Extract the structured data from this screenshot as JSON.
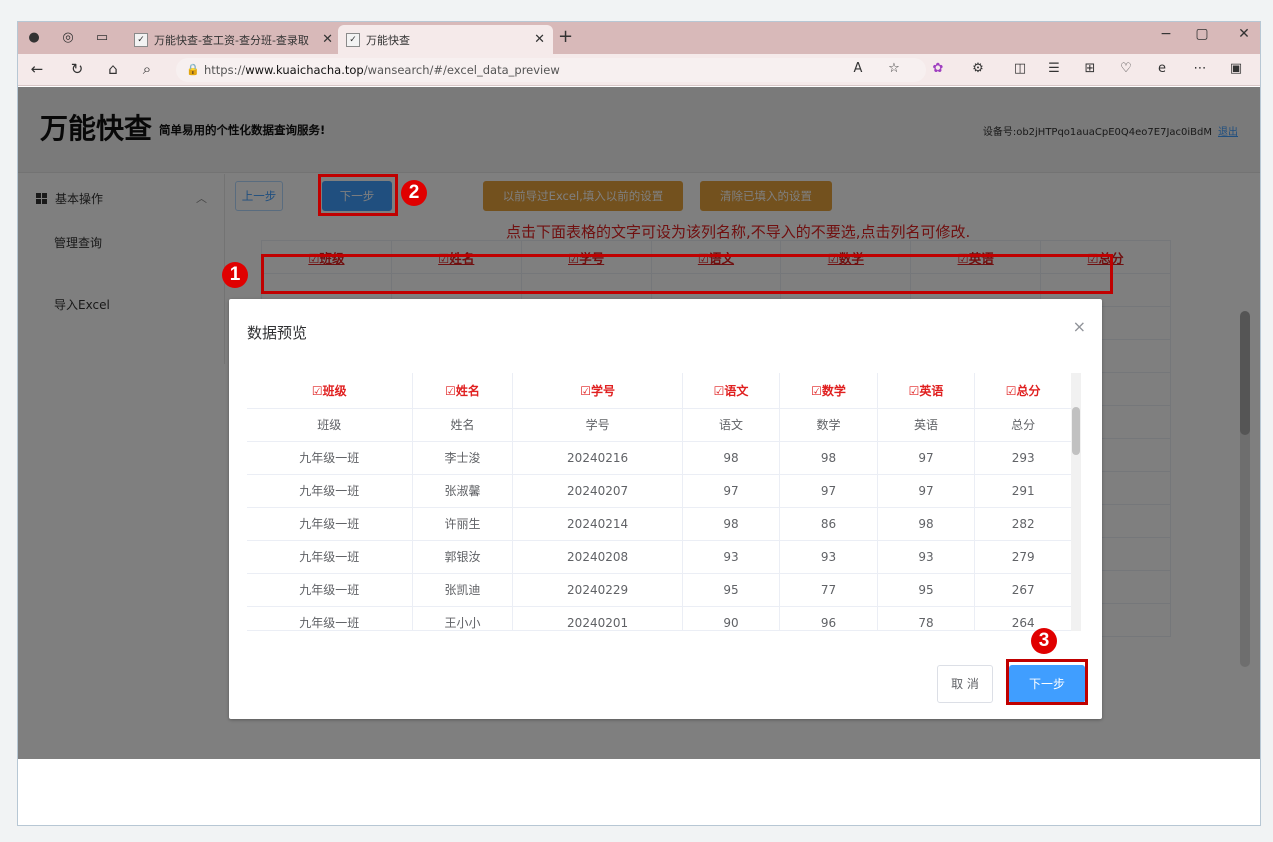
{
  "browser": {
    "tabs": [
      {
        "title": "万能快查-查工资-查分班-查录取",
        "active": false
      },
      {
        "title": "万能快查",
        "active": true
      }
    ],
    "new_tab": "+",
    "url_prefix": "https://",
    "url_domain": "www.kuaichacha.top",
    "url_path": "/wansearch/#/excel_data_preview",
    "window_controls": [
      "−",
      "▢",
      "✕"
    ]
  },
  "header": {
    "logo": "万能快查",
    "slogan": "简单易用的个性化数据查询服务!",
    "device_label": "设备号:ob2jHTPqo1auaCpE0Q4eo7E7Jac0iBdM",
    "logout": "退出"
  },
  "sidebar": {
    "group": "基本操作",
    "items": [
      "管理查询",
      "导入Excel"
    ]
  },
  "toolbar": {
    "prev": "上一步",
    "next": "下一步",
    "load_previous": "以前导过Excel,填入以前的设置",
    "clear": "清除已填入的设置"
  },
  "hint": "点击下面表格的文字可设为该列名称,不导入的不要选,点击列名可修改.",
  "columns": [
    "☑班级",
    "☑姓名",
    "☑学号",
    "☑语文",
    "☑数学",
    "☑英语",
    "☑总分"
  ],
  "dialog": {
    "title": "数据预览",
    "close": "×",
    "columns": [
      "☑班级",
      "☑姓名",
      "☑学号",
      "☑语文",
      "☑数学",
      "☑英语",
      "☑总分"
    ],
    "rows": [
      [
        "班级",
        "姓名",
        "学号",
        "语文",
        "数学",
        "英语",
        "总分"
      ],
      [
        "九年级一班",
        "李士浚",
        "20240216",
        "98",
        "98",
        "97",
        "293"
      ],
      [
        "九年级一班",
        "张淑馨",
        "20240207",
        "97",
        "97",
        "97",
        "291"
      ],
      [
        "九年级一班",
        "许丽生",
        "20240214",
        "98",
        "86",
        "98",
        "282"
      ],
      [
        "九年级一班",
        "郭银汝",
        "20240208",
        "93",
        "93",
        "93",
        "279"
      ],
      [
        "九年级一班",
        "张凯迪",
        "20240229",
        "95",
        "77",
        "95",
        "267"
      ],
      [
        "九年级一班",
        "王小小",
        "20240201",
        "90",
        "96",
        "78",
        "264"
      ]
    ],
    "cancel": "取 消",
    "next": "下一步"
  },
  "annotations": [
    "1",
    "2",
    "3"
  ],
  "colors": {
    "accent": "#409eff",
    "warning": "#e6a23c",
    "highlight_red": "#c00000",
    "header_red": "#e02020"
  }
}
